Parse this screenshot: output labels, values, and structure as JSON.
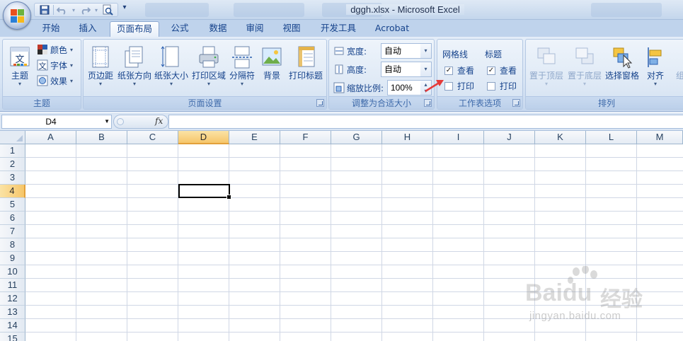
{
  "window": {
    "title": "dggh.xlsx - Microsoft Excel"
  },
  "quick_access": {
    "icons": [
      "save-icon",
      "undo-icon",
      "redo-icon",
      "print-preview-icon"
    ]
  },
  "tabs": [
    {
      "label": "开始"
    },
    {
      "label": "插入"
    },
    {
      "label": "页面布局",
      "active": true
    },
    {
      "label": "公式"
    },
    {
      "label": "数据"
    },
    {
      "label": "审阅"
    },
    {
      "label": "视图"
    },
    {
      "label": "开发工具"
    },
    {
      "label": "Acrobat"
    }
  ],
  "ribbon": {
    "themes": {
      "group_label": "主题",
      "themes_button": "主题",
      "colors": "颜色",
      "fonts": "字体",
      "effects": "效果"
    },
    "page_setup": {
      "group_label": "页面设置",
      "margins": "页边距",
      "orientation": "纸张方向",
      "size": "纸张大小",
      "print_area": "打印区域",
      "breaks": "分隔符",
      "background": "背景",
      "print_titles": "打印标题"
    },
    "scale_to_fit": {
      "group_label": "调整为合适大小",
      "width_label": "宽度:",
      "width_value": "自动",
      "height_label": "高度:",
      "height_value": "自动",
      "scale_label": "缩放比例:",
      "scale_value": "100%"
    },
    "sheet_options": {
      "group_label": "工作表选项",
      "gridlines_heading": "网格线",
      "gridlines_view": "查看",
      "gridlines_view_checked": true,
      "gridlines_print": "打印",
      "gridlines_print_checked": false,
      "headings_heading": "标题",
      "headings_view": "查看",
      "headings_view_checked": true,
      "headings_print": "打印",
      "headings_print_checked": false
    },
    "arrange": {
      "group_label": "排列",
      "bring_to_front": "置于顶层",
      "send_to_back": "置于底层",
      "selection_pane": "选择窗格",
      "align": "对齐",
      "group_partial": "组"
    }
  },
  "formula_bar": {
    "name_box": "D4",
    "fx_label": "fx",
    "formula": ""
  },
  "grid": {
    "columns": [
      "A",
      "B",
      "C",
      "D",
      "E",
      "F",
      "G",
      "H",
      "I",
      "J",
      "K",
      "L",
      "M"
    ],
    "rows": [
      "1",
      "2",
      "3",
      "4",
      "5",
      "6",
      "7",
      "8",
      "9",
      "10",
      "11",
      "12",
      "13",
      "14",
      "15"
    ],
    "active_column": "D",
    "active_row": "4"
  },
  "watermark": {
    "brand": "Baidu",
    "brand_cn": "经验",
    "url": "jingyan.baidu.com"
  },
  "colors": {
    "ribbon_text": "#15428b",
    "annotation_arrow": "#e53a3a",
    "selection_header": "#f6c66a"
  }
}
